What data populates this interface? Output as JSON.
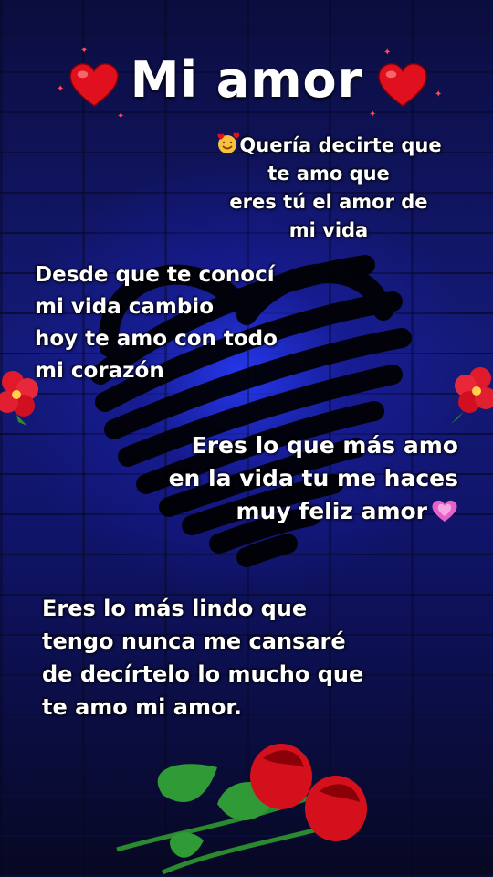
{
  "title": "Mi amor",
  "messages": {
    "p1": "Quería decirte que\nte amo que\neres tú el amor de\nmi vida",
    "p2": "Desde que te conocí\nmi vida cambio\nhoy te amo con todo\nmi corazón",
    "p3a": "Eres lo que más amo\nen la vida tu me haces\nmuy feliz amor",
    "p4": "Eres lo más lindo que\ntengo nunca me cansaré\nde decírtelo lo mucho que\nte amo mi amor."
  },
  "icons": [
    "red-heart-icon",
    "smiling-face-hearts-icon",
    "growing-heart-icon",
    "hibiscus-icon",
    "red-rose-icon"
  ],
  "colors": {
    "background": "#0b0d3e",
    "glow": "#2a3cff",
    "text": "#ffffff",
    "heart": "#e0101e",
    "pink_heart": "#e860c8"
  }
}
